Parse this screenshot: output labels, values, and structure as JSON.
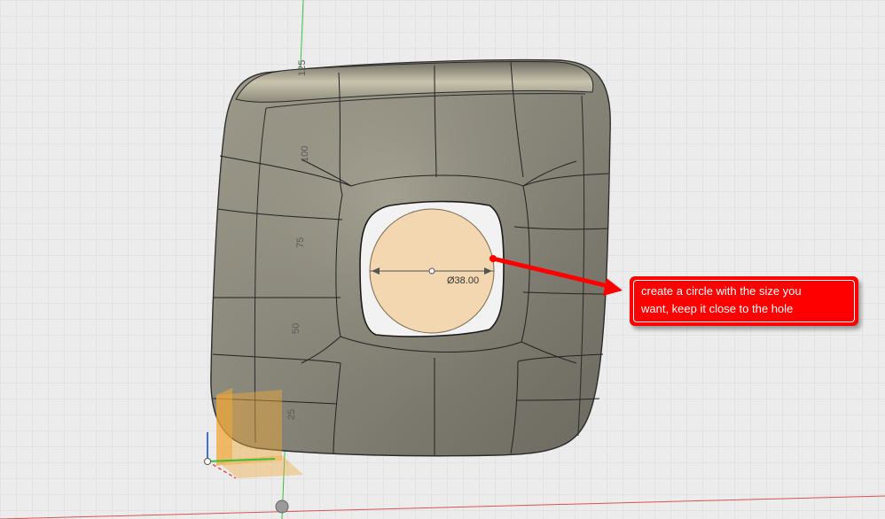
{
  "viewport": {
    "background": "#ececec",
    "grid_color": "#d6d6d6",
    "axis_colors": {
      "x": "#e05050",
      "y": "#3bbf3b",
      "z": "#3b6fe0"
    }
  },
  "ruler_labels": [
    "125",
    "100",
    "75",
    "50",
    "25"
  ],
  "dimension": {
    "label": "Ø38.00"
  },
  "sketch_circle": {
    "fill": "#f3d4a8"
  },
  "body": {
    "color": "#8c8a7c"
  },
  "callout": {
    "text": "create a circle with the size you\nwant, keep it close to the hole",
    "color": "#ff0000"
  },
  "icons": [
    "origin-icon",
    "arrow-icon"
  ]
}
